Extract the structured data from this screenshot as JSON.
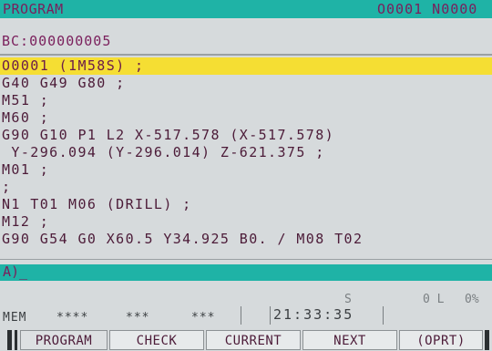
{
  "header": {
    "title": "PROGRAM",
    "program_number": "O0001 N0000"
  },
  "sequence": {
    "text": "BC:000000005"
  },
  "code_lines": [
    {
      "text": "O0001 (1M58S) ;",
      "highlight": true
    },
    {
      "text": "G40 G49 G80 ;",
      "highlight": false
    },
    {
      "text": "M51 ;",
      "highlight": false
    },
    {
      "text": "M60 ;",
      "highlight": false
    },
    {
      "text": "G90 G10 P1 L2 X-517.578 (X-517.578)",
      "highlight": false
    },
    {
      "text": " Y-296.094 (Y-296.014) Z-621.375 ;",
      "highlight": false
    },
    {
      "text": "M01 ;",
      "highlight": false
    },
    {
      "text": ";",
      "highlight": false
    },
    {
      "text": "N1 T01 M06 (DRILL) ;",
      "highlight": false
    },
    {
      "text": "M12 ;",
      "highlight": false
    },
    {
      "text": "G90 G54 G0 X60.5 Y34.925 B0. / M08 T02",
      "highlight": false
    }
  ],
  "input": {
    "text": "A)_"
  },
  "status": {
    "s_label": "S",
    "ol_label": "0 L",
    "percent": "0%",
    "mode": "MEM",
    "stars1": "****",
    "stars2": "***",
    "stars3": "***",
    "time": "21:33:35"
  },
  "softkeys": {
    "program": "PROGRAM",
    "check": "CHECK",
    "current": "CURRENT",
    "next": "NEXT",
    "oprt": "(OPRT)"
  },
  "colors": {
    "header_bg": "#1fb3a6",
    "highlight_bg": "#f5de33",
    "text": "#4c1b38"
  }
}
